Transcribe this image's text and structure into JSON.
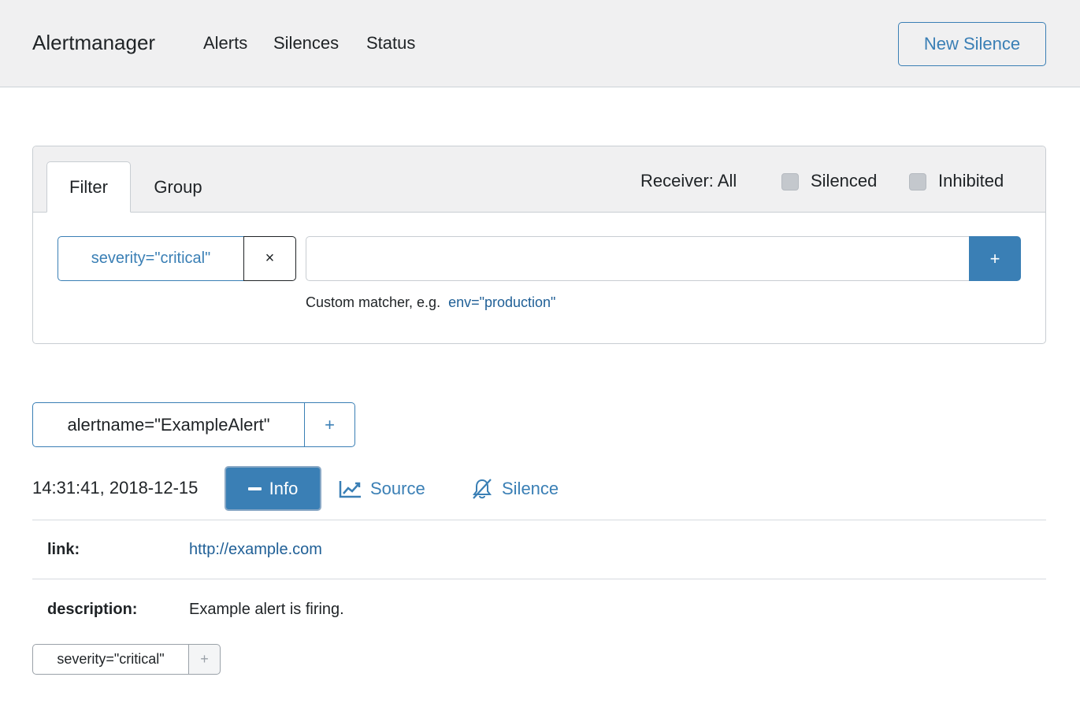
{
  "navbar": {
    "brand": "Alertmanager",
    "links": [
      "Alerts",
      "Silences",
      "Status"
    ],
    "new_silence_label": "New Silence"
  },
  "filter_card": {
    "tabs": [
      "Filter",
      "Group"
    ],
    "receiver_label": "Receiver: All",
    "silenced_label": "Silenced",
    "inhibited_label": "Inhibited",
    "active_matcher": "severity=\"critical\"",
    "remove_symbol": "×",
    "custom_input_value": "",
    "add_symbol": "+",
    "hint_text": "Custom matcher, e.g.",
    "hint_example": "env=\"production\""
  },
  "group": {
    "label": "alertname=\"ExampleAlert\"",
    "add_symbol": "+"
  },
  "alert": {
    "timestamp": "14:31:41, 2018-12-15",
    "info_label": "Info",
    "source_label": "Source",
    "silence_label": "Silence",
    "annotations": [
      {
        "key": "link:",
        "value": "http://example.com"
      },
      {
        "key": "description:",
        "value": "Example alert is firing."
      }
    ],
    "label_pill": "severity=\"critical\"",
    "label_add_symbol": "+"
  },
  "colors": {
    "accent": "#3a7fb5",
    "navbar_bg": "#f0f0f1",
    "text": "#1f2326"
  }
}
